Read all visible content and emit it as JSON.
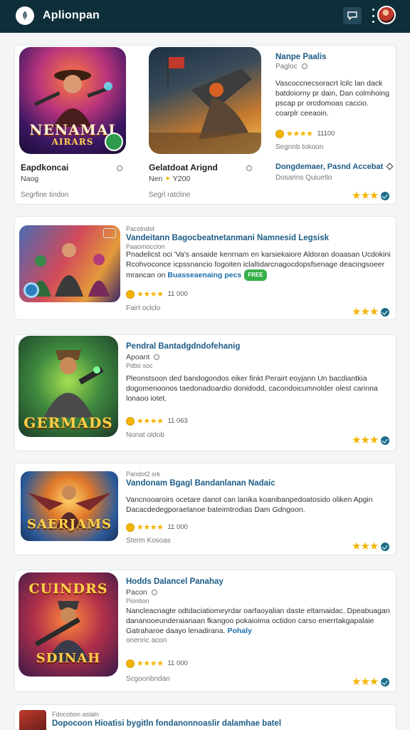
{
  "header": {
    "title": "Aplionpan"
  },
  "featured": {
    "left": {
      "poster_text_1": "NENAMAI",
      "poster_text_2": "AIRARS",
      "title": "Eapdkoncai",
      "subtitle": "Naog",
      "meta": "Segrfine tindon"
    },
    "middle": {
      "title": "Gelatdoat Arignd",
      "subtitle": "Nen",
      "subtitle_tail": "Y200",
      "meta": "Segrl ratcline"
    },
    "right": {
      "title": "Nanpe Paalis",
      "subtitle": "Pagloc",
      "body": "Vascoccnecsoracrt lcilc lan dack batdoiorny pr dain, Dan colmhoing pscap pr orcdomoas caccio. coarplr ceeaoin.",
      "rating_count": "11100",
      "meta": "Segnnb tokoon",
      "footer_title": "Dongdemaer, Pasnd Accebat",
      "footer_sub": "Dosarins Quiuetlo"
    }
  },
  "list": [
    {
      "kicker": "Pacolndot",
      "title": "Vandeitann Bagocbeatnetanmani Namnesid Legsisk",
      "subtitle": "Paaomocclon",
      "body": "Pnadelicst oci 'Va's ansaide kenrnam en karsiekaiore Aldoran doaasan Ucdokini Rcohvoconce icpssnancio fogoiten iclaltidarcnagocdopsfsenage deacingsoeer mrancan on",
      "link": "Buasseaenaing pecs",
      "pill": "FREE",
      "rating_count": "11 000",
      "meta": "Fairt oclclo"
    },
    {
      "poster": "GERMADS",
      "title": "Pendral Bantadgdndofehanig",
      "subtitle": "Apoant",
      "kicker": "Pdbo soc",
      "body": "Pleonstsoon ded bandogondos eiker finkt Perairt eoyjann Un bacdiantkia dogomenoonos taedonadoardio donidodd, cacondoicumnolder olest carinna lonaoo iotet.",
      "rating_count": "11 063",
      "meta": "Nonat oldob"
    },
    {
      "poster": "SAERJAMS",
      "kicker": "Pandot2 srk",
      "title": "Vandonam Bgagl Bandanlanan Nadaic",
      "body": "Vancnooaroirs ocetare danot can lanika koanibanpedoatosido oliken Apgin Dacacdedegporaelanoe bateimtrodias Dam Gdngoon.",
      "rating_count": "11 000",
      "meta": "Sterm Kosoas"
    },
    {
      "poster_top": "CUINDRS",
      "poster_bottom": "SDINAH",
      "title": "Hodds Dalancel Panahay",
      "subtitle": "Pacon",
      "kicker": "Piontion",
      "body": "Nancleacnagte odtdaciatiomeyrdar oarfaoyalian daste eltamaidac, Dpeabuagan dananooeunderaianaan fkangoo pokaioima octidon carso enerrtakgapalaie Gatraharoe daayo lenadirana.",
      "link": "Pohaly",
      "tail": "onenric acon",
      "rating_count": "11 000",
      "meta": "Scgoonbndan"
    }
  ],
  "partial": {
    "kicker": "Fdocobon aslaln",
    "title": "Dopocoon Hioatisi bygitln fondanonnoaslir dalamhae batel"
  },
  "colors": {
    "header_bg": "#0e2f3a",
    "accent_blue": "#1c5c86",
    "star_gold": "#f2b400",
    "badge_green": "#36b04a"
  }
}
